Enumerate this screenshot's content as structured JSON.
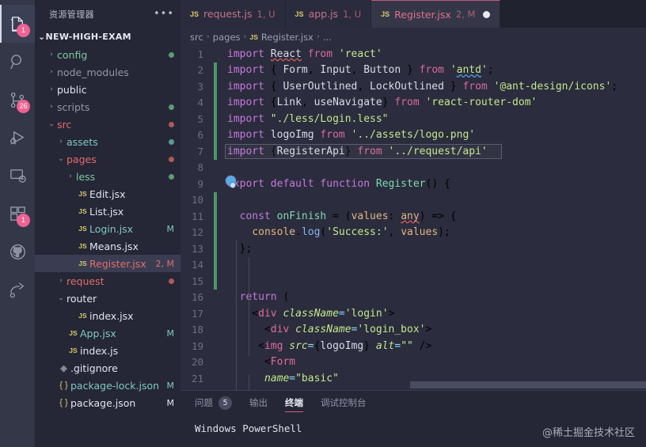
{
  "activitybar": {
    "items": [
      {
        "name": "explorer",
        "icon": "files-icon",
        "badge": "1",
        "active": true
      },
      {
        "name": "search",
        "icon": "search-icon",
        "badge": ""
      },
      {
        "name": "source-control",
        "icon": "source-control-icon",
        "badge": "26"
      },
      {
        "name": "run-and-debug",
        "icon": "run-debug-icon",
        "badge": ""
      },
      {
        "name": "remote-explorer",
        "icon": "remote-explorer-icon",
        "badge": ""
      },
      {
        "name": "extensions",
        "icon": "extensions-icon",
        "badge": "1"
      },
      {
        "name": "github",
        "icon": "github-icon",
        "badge": ""
      },
      {
        "name": "share",
        "icon": "share-icon",
        "badge": ""
      }
    ]
  },
  "sidebar": {
    "title": "资源管理器",
    "more_label": "•••",
    "root": {
      "label": "NEW-HIGH-EXAM",
      "twisty": "⌄"
    },
    "tree": [
      {
        "twisty": "›",
        "indent": 14,
        "label": "config",
        "kind": "folder",
        "color": "c-green",
        "dot": "d-green",
        "badge": ""
      },
      {
        "twisty": "›",
        "indent": 14,
        "label": "node_modules",
        "kind": "folder",
        "color": "c-grey",
        "dot": "",
        "badge": ""
      },
      {
        "twisty": "›",
        "indent": 14,
        "label": "public",
        "kind": "folder",
        "color": "c-white",
        "dot": "",
        "badge": ""
      },
      {
        "twisty": "›",
        "indent": 14,
        "label": "scripts",
        "kind": "folder",
        "color": "c-grey",
        "dot": "d-green",
        "badge": ""
      },
      {
        "twisty": "⌄",
        "indent": 14,
        "label": "src",
        "kind": "folder",
        "color": "c-red",
        "dot": "d-red",
        "badge": ""
      },
      {
        "twisty": "›",
        "indent": 26,
        "label": "assets",
        "kind": "folder",
        "color": "c-blue",
        "dot": "d-teal",
        "badge": ""
      },
      {
        "twisty": "⌄",
        "indent": 26,
        "label": "pages",
        "kind": "folder",
        "color": "c-red",
        "dot": "d-red",
        "badge": ""
      },
      {
        "twisty": "›",
        "indent": 38,
        "label": "less",
        "kind": "folder",
        "color": "c-green",
        "dot": "d-green",
        "badge": ""
      },
      {
        "twisty": "",
        "indent": 38,
        "label": "Edit.jsx",
        "kind": "js",
        "color": "c-white",
        "dot": "",
        "badge": ""
      },
      {
        "twisty": "",
        "indent": 38,
        "label": "List.jsx",
        "kind": "js",
        "color": "c-white",
        "dot": "",
        "badge": ""
      },
      {
        "twisty": "",
        "indent": 38,
        "label": "Login.jsx",
        "kind": "js",
        "color": "c-blue",
        "dot": "",
        "badge": "M"
      },
      {
        "twisty": "",
        "indent": 38,
        "label": "Means.jsx",
        "kind": "js",
        "color": "c-white",
        "dot": "",
        "badge": ""
      },
      {
        "twisty": "",
        "indent": 38,
        "label": "Register.jsx",
        "kind": "js",
        "color": "c-red",
        "dot": "",
        "badge": "2, M",
        "selected": true
      },
      {
        "twisty": "›",
        "indent": 26,
        "label": "request",
        "kind": "folder",
        "color": "c-red",
        "dot": "d-red",
        "badge": ""
      },
      {
        "twisty": "⌄",
        "indent": 26,
        "label": "router",
        "kind": "folder",
        "color": "c-white",
        "dot": "",
        "badge": ""
      },
      {
        "twisty": "",
        "indent": 38,
        "label": "index.jsx",
        "kind": "js",
        "color": "c-white",
        "dot": "",
        "badge": ""
      },
      {
        "twisty": "",
        "indent": 26,
        "label": "App.jsx",
        "kind": "js",
        "color": "c-blue",
        "dot": "",
        "badge": "M"
      },
      {
        "twisty": "",
        "indent": 26,
        "label": "index.js",
        "kind": "js",
        "color": "c-white",
        "dot": "",
        "badge": ""
      },
      {
        "twisty": "",
        "indent": 14,
        "label": ".gitignore",
        "kind": "git",
        "color": "c-white",
        "dot": "",
        "badge": ""
      },
      {
        "twisty": "",
        "indent": 14,
        "label": "package-lock.json",
        "kind": "json",
        "color": "c-blue",
        "dot": "",
        "badge": "M"
      },
      {
        "twisty": "",
        "indent": 14,
        "label": "package.json",
        "kind": "json",
        "color": "c-white",
        "dot": "",
        "badge": "M"
      }
    ]
  },
  "tabs": [
    {
      "icon": "js-file-icon",
      "name": "request.js",
      "meta": "1, U",
      "active": false,
      "dirty": false
    },
    {
      "icon": "js-file-icon",
      "name": "app.js",
      "meta": "1, U",
      "active": false,
      "dirty": false
    },
    {
      "icon": "js-file-icon",
      "name": "Register.jsx",
      "meta": "2, M",
      "active": true,
      "dirty": true
    }
  ],
  "breadcrumb": {
    "parts": [
      "src",
      "pages",
      "Register.jsx",
      "..."
    ],
    "separator": "›",
    "file_icon_label": "JS"
  },
  "editor": {
    "lines": [
      {
        "n": "1",
        "changed": false
      },
      {
        "n": "2",
        "changed": true
      },
      {
        "n": "3",
        "changed": true
      },
      {
        "n": "4",
        "changed": true
      },
      {
        "n": "5",
        "changed": true
      },
      {
        "n": "6",
        "changed": true
      },
      {
        "n": "7",
        "changed": true
      },
      {
        "n": "8",
        "changed": false
      },
      {
        "n": "9",
        "changed": false
      },
      {
        "n": "10",
        "changed": true
      },
      {
        "n": "11",
        "changed": true
      },
      {
        "n": "12",
        "changed": true
      },
      {
        "n": "13",
        "changed": true
      },
      {
        "n": "14",
        "changed": true
      },
      {
        "n": "15",
        "changed": true
      },
      {
        "n": "16",
        "changed": false
      },
      {
        "n": "17",
        "changed": false
      },
      {
        "n": "18",
        "changed": false
      },
      {
        "n": "19",
        "changed": false
      },
      {
        "n": "20",
        "changed": false
      },
      {
        "n": "21",
        "changed": false
      }
    ],
    "code": [
      "import React from 'react'",
      "import { Form, Input, Button } from 'antd';",
      "import { UserOutlined, LockOutlined } from '@ant-design/icons';",
      "import {Link, useNavigate} from 'react-router-dom'",
      "import \"./less/Login.less\"",
      "import logoImg from '../assets/logo.png'",
      "import {RegisterApi} from '../request/api'",
      "",
      "export default function Register() {",
      "",
      "  const onFinish = (values: any) => {",
      "    console.log('Success:', values);",
      "  };",
      "",
      "",
      "  return (",
      "    <div className='login'>",
      "      <div className='login_box'>",
      "     <img src={logoImg} alt=\"\" />",
      "      <Form",
      "      name=\"basic\""
    ]
  },
  "panel": {
    "tabs": [
      {
        "label": "问题",
        "count": "5",
        "active": false
      },
      {
        "label": "输出",
        "count": "",
        "active": false
      },
      {
        "label": "终端",
        "count": "",
        "active": true
      },
      {
        "label": "调试控制台",
        "count": "",
        "active": false
      }
    ],
    "terminal_line": "Windows PowerShell"
  },
  "watermark": "@稀土掘金技术社区",
  "colors": {
    "activitybar_bg": "#333748",
    "sidebar_bg": "#252636",
    "editor_bg": "#2b2c3d",
    "tab_active_bg": "#353749",
    "accent_pink": "#d35a86",
    "badge_pink": "#f06292",
    "git_modified": "#7fc8c0",
    "change_bar_green": "#4c9669"
  }
}
